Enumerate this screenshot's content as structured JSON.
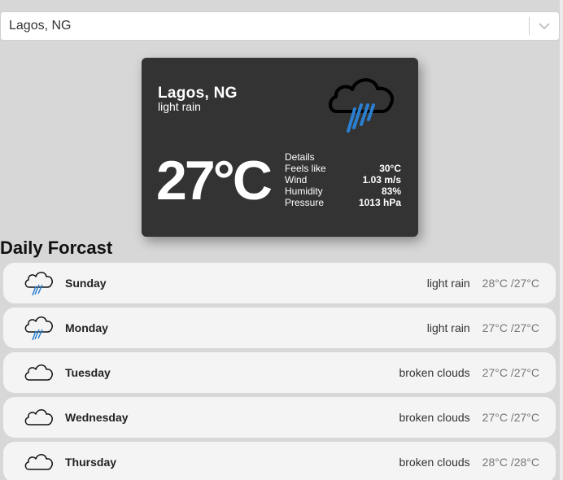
{
  "search": {
    "selected_value": "Lagos, NG",
    "dropdown_icon": "chevron-down-icon"
  },
  "current": {
    "city": "Lagos, NG",
    "description": "light rain",
    "icon": "rain-cloud-icon",
    "temperature": "27°C",
    "details_title": "Details",
    "details": [
      {
        "label": "Feels like",
        "value": "30°C"
      },
      {
        "label": "Wind",
        "value": "1.03 m/s"
      },
      {
        "label": "Humidity",
        "value": "83%"
      },
      {
        "label": "Pressure",
        "value": "1013 hPa"
      }
    ],
    "colors": {
      "card_bg": "#333333",
      "rain_accent": "#2b7fd0"
    }
  },
  "forecast": {
    "title": "Daily Forcast",
    "days": [
      {
        "day": "Sunday",
        "condition": "light rain",
        "range": "28°C /27°C",
        "icon": "rain-cloud-icon"
      },
      {
        "day": "Monday",
        "condition": "light rain",
        "range": "27°C /27°C",
        "icon": "rain-cloud-icon"
      },
      {
        "day": "Tuesday",
        "condition": "broken clouds",
        "range": "27°C /27°C",
        "icon": "cloud-icon"
      },
      {
        "day": "Wednesday",
        "condition": "broken clouds",
        "range": "27°C /27°C",
        "icon": "cloud-icon"
      },
      {
        "day": "Thursday",
        "condition": "broken clouds",
        "range": "28°C /28°C",
        "icon": "cloud-icon"
      }
    ]
  }
}
